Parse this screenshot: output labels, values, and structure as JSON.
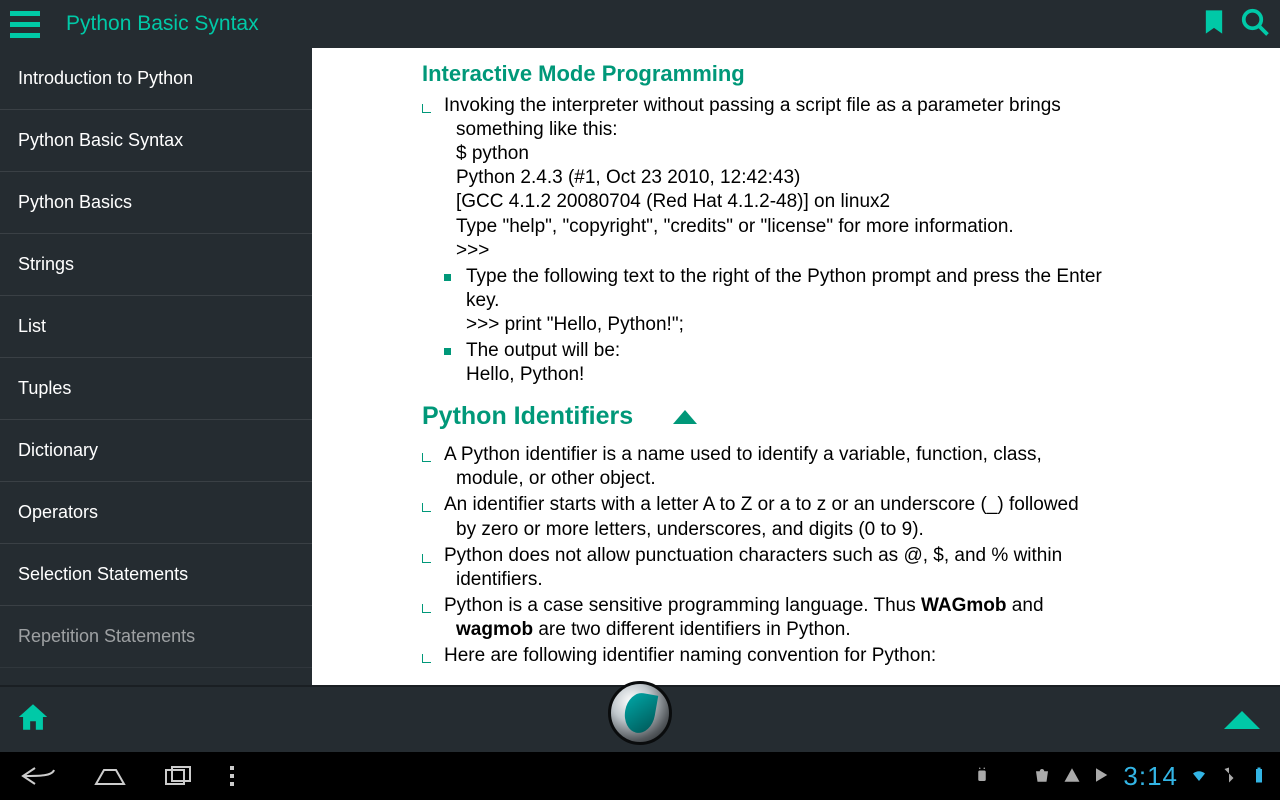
{
  "header": {
    "title": "Python Basic Syntax"
  },
  "sidebar": {
    "items": [
      "Introduction to Python",
      "Python Basic Syntax",
      "Python Basics",
      "Strings",
      "List",
      "Tuples",
      "Dictionary",
      "Operators",
      "Selection Statements",
      "Repetition Statements"
    ]
  },
  "content": {
    "section1": {
      "title": "Interactive Mode Programming",
      "b1_l1": "Invoking the interpreter without passing a script file as a parameter brings",
      "b1_l2": "something like this:",
      "b1_l3": "$ python",
      "b1_l4": "Python 2.4.3 (#1, Oct 23 2010, 12:42:43)",
      "b1_l5": "[GCC 4.1.2 20080704 (Red Hat 4.1.2-48)] on linux2",
      "b1_l6": "Type \"help\", \"copyright\", \"credits\" or \"license\" for more information.",
      "b1_l7": ">>>",
      "b2_l1": "Type the following text to the right of the Python prompt and press the Enter",
      "b2_l2": "key.",
      "b2_l3": ">>> print \"Hello, Python!\";",
      "b3_l1": "The output will be:",
      "b3_l2": "Hello, Python!"
    },
    "section2": {
      "title": "Python Identifiers",
      "b1_l1": "A Python identifier is a name used to identify a variable, function, class,",
      "b1_l2": "module, or other object.",
      "b2_l1": "An identifier starts with a letter A to Z or a to z or an underscore (_) followed",
      "b2_l2": "by zero or more letters, underscores, and digits (0 to 9).",
      "b3_l1": "Python does not allow punctuation characters such as @, $, and % within",
      "b3_l2": "identifiers.",
      "b4_pre": "Python is a case sensitive programming language. Thus ",
      "b4_bold1": "WAGmob",
      "b4_mid": " and",
      "b4_bold2": "wagmob",
      "b4_post": " are two different identifiers in Python.",
      "b5_l1": "Here are following identifier naming convention for Python:"
    }
  },
  "statusbar": {
    "clock": "3:14"
  }
}
